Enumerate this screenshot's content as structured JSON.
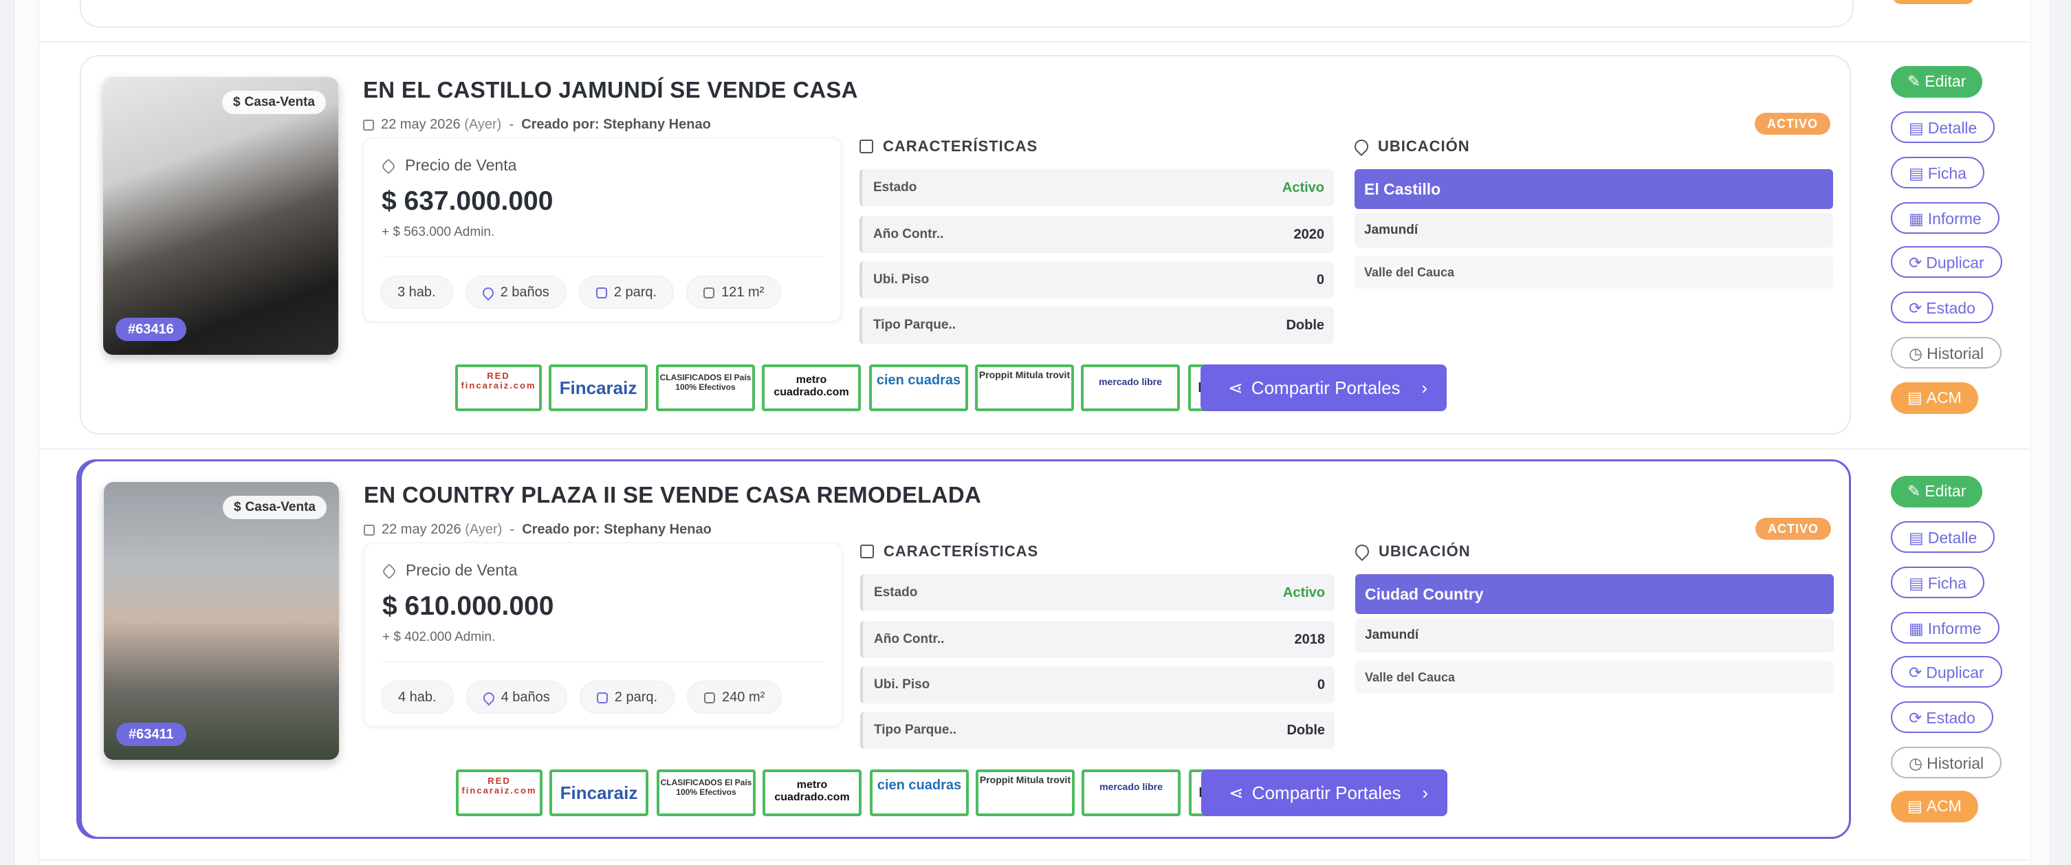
{
  "listings": [
    {
      "title": "EN EL CASTILLO JAMUNDÍ SE VENDE CASA",
      "date": "22 may 2026",
      "relative": "(Ayer)",
      "created_by": "Creado por: Stephany Henao",
      "status_badge": "ACTIVO",
      "photo_badge": "Casa-Venta",
      "photo_id": "#63416",
      "price_label": "Precio de Venta",
      "price": "$ 637.000.000",
      "admin": "+ $ 563.000 Admin.",
      "features": [
        "3 hab.",
        "2 baños",
        "2 parq.",
        "121 m²"
      ],
      "characteristics_title": "CARACTERÍSTICAS",
      "characteristics": [
        {
          "k": "Estado",
          "v": "Activo"
        },
        {
          "k": "Año Contr..",
          "v": "2020"
        },
        {
          "k": "Ubi. Piso",
          "v": "0"
        },
        {
          "k": "Tipo Parque..",
          "v": "Doble"
        }
      ],
      "location_title": "UBICACIÓN",
      "location": {
        "barrio": "El Castillo",
        "ciudad": "Jamundí",
        "depto": "Valle del Cauca"
      },
      "share_label": "Compartir Portales",
      "selected": false
    },
    {
      "title": "EN COUNTRY PLAZA II SE VENDE CASA REMODELADA",
      "date": "22 may 2026",
      "relative": "(Ayer)",
      "created_by": "Creado por: Stephany Henao",
      "status_badge": "ACTIVO",
      "photo_badge": "Casa-Venta",
      "photo_id": "#63411",
      "price_label": "Precio de Venta",
      "price": "$ 610.000.000",
      "admin": "+ $ 402.000 Admin.",
      "features": [
        "4 hab.",
        "4 baños",
        "2 parq.",
        "240 m²"
      ],
      "characteristics_title": "CARACTERÍSTICAS",
      "characteristics": [
        {
          "k": "Estado",
          "v": "Activo"
        },
        {
          "k": "Año Contr..",
          "v": "2018"
        },
        {
          "k": "Ubi. Piso",
          "v": "0"
        },
        {
          "k": "Tipo Parque..",
          "v": "Doble"
        }
      ],
      "location_title": "UBICACIÓN",
      "location": {
        "barrio": "Ciudad Country",
        "ciudad": "Jamundí",
        "depto": "Valle del Cauca"
      },
      "share_label": "Compartir Portales",
      "selected": true
    }
  ],
  "portals": [
    {
      "name": "RED fincaraiz.com"
    },
    {
      "name": "Fincaraiz"
    },
    {
      "name": "CLASIFICADOS El País 100% Efectivos"
    },
    {
      "name": "metro cuadrado.com"
    },
    {
      "name": "cien cuadras"
    },
    {
      "name": "Proppit Mitula trovit"
    },
    {
      "name": "mercado libre"
    },
    {
      "name": "Properstar"
    }
  ],
  "actions": [
    "Editar",
    "Detalle",
    "Ficha",
    "Informe",
    "Duplicar",
    "Estado",
    "Historial",
    "ACM"
  ],
  "colors": {
    "accent": "#6f6bdf",
    "green": "#47b865",
    "orange": "#f7a64f",
    "status_green": "#3aa049"
  }
}
